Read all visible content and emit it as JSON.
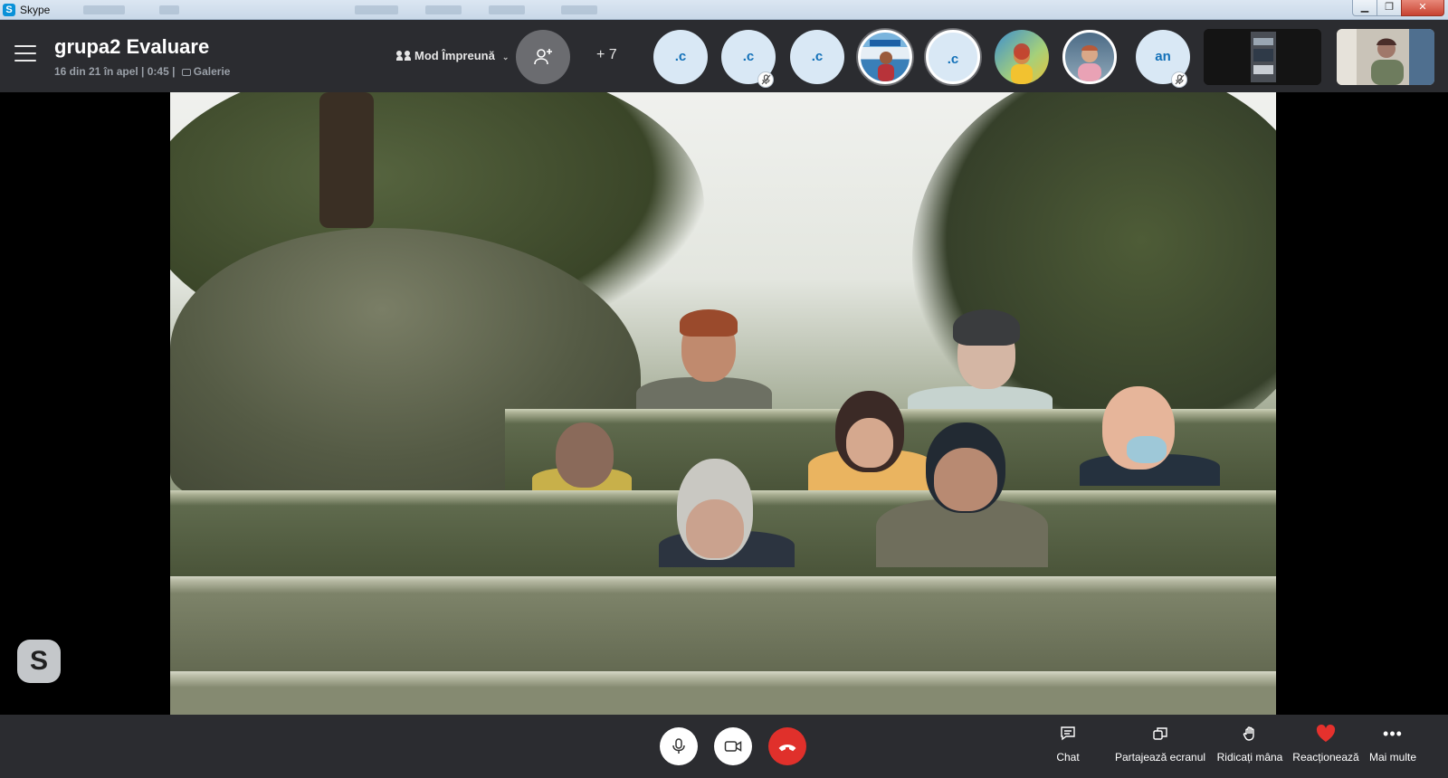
{
  "window": {
    "app_title": "Skype",
    "app_icon": "skype-logo-icon",
    "minimize_icon": "minimize-icon",
    "maximize_icon": "restore-icon",
    "close_icon": "close-icon"
  },
  "call": {
    "title": "grupa2 Evaluare",
    "subtitle": "16 din 21 în apel | 0:45 |",
    "view_label": "Galerie",
    "mode_label": "Mod Împreună",
    "more_participants": "+ 7"
  },
  "participants": [
    {
      "initials": ".c",
      "type": "initials",
      "muted": false
    },
    {
      "initials": ".c",
      "type": "initials",
      "muted": true
    },
    {
      "initials": ".c",
      "type": "initials",
      "muted": false
    },
    {
      "initials": "",
      "type": "photo",
      "muted": false,
      "active": true
    },
    {
      "initials": ".c",
      "type": "initials",
      "muted": false,
      "active": true
    },
    {
      "initials": "",
      "type": "photo",
      "muted": false
    },
    {
      "initials": "",
      "type": "photo",
      "muted": false
    },
    {
      "initials": "an",
      "type": "initials",
      "muted": true
    }
  ],
  "controls": {
    "mic_icon": "microphone-icon",
    "camera_icon": "video-camera-icon",
    "hangup_icon": "hang-up-icon",
    "chat_label": "Chat",
    "share_label": "Partajează ecranul",
    "raise_hand_label": "Ridicați mâna",
    "react_label": "Reacționează",
    "more_label": "Mai multe"
  },
  "colors": {
    "bar_background": "#2b2c30",
    "avatar_fill": "#d9e8f5",
    "avatar_text": "#1270b8",
    "hangup_red": "#e0302b",
    "react_heart": "#e5312d"
  }
}
